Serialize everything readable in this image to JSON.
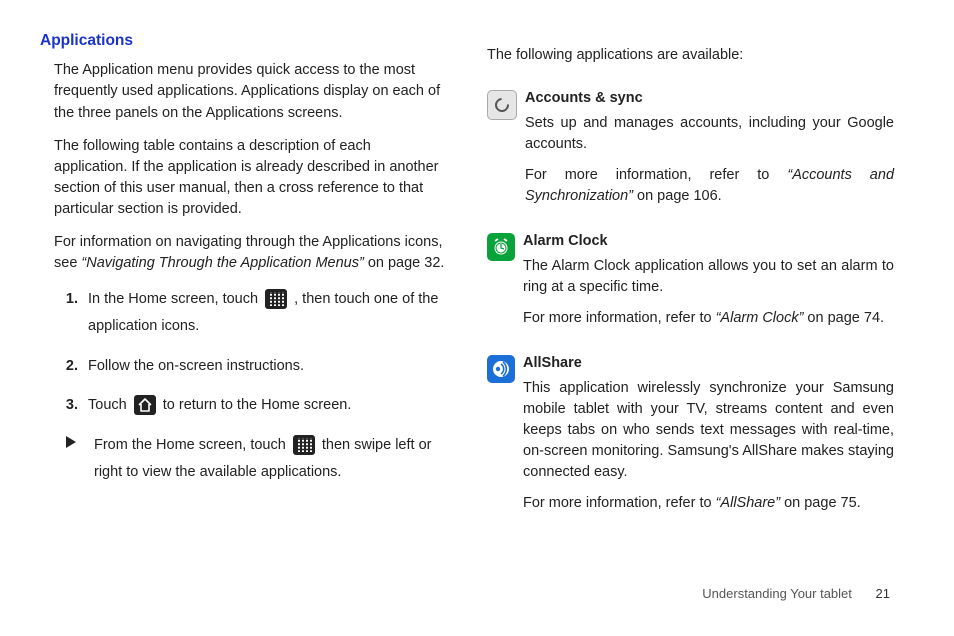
{
  "left": {
    "heading": "Applications",
    "p1": "The Application menu provides quick access to the most frequently used applications. Applications display on each of the three panels on the Applications screens.",
    "p2": "The following table contains a description of each application. If the application is already described in another section of this user manual, then a cross reference to that particular section is provided.",
    "p3a": "For information on navigating through the Applications icons, see ",
    "p3ref": "“Navigating Through the Application Menus”",
    "p3b": " on page 32.",
    "step1a": "In the Home screen, touch ",
    "step1b": " , then touch one of the application icons.",
    "step2": "Follow the on-screen instructions.",
    "step3a": "Touch ",
    "step3b": " to return to the Home screen.",
    "bulleta": "From the Home screen, touch ",
    "bulletb": " then swipe left or right to view the available applications."
  },
  "right": {
    "intro": "The following applications are available:",
    "apps": {
      "sync": {
        "title": "Accounts & sync",
        "desc": "Sets up and manages accounts, including your Google accounts.",
        "morea": "For more information, refer to ",
        "moreref": "“Accounts and Synchronization”",
        "moreb": "  on page 106."
      },
      "alarm": {
        "title": "Alarm Clock",
        "desc": "The Alarm Clock application allows you to set an alarm to ring at a specific time.",
        "morea": "For more information, refer to ",
        "moreref": "“Alarm Clock”",
        "moreb": "  on page 74."
      },
      "allshare": {
        "title": "AllShare",
        "desc": "This application wirelessly synchronize your Samsung mobile tablet with your TV, streams content and even keeps tabs on who sends text messages with real-time, on-screen monitoring. Samsung's AllShare makes staying connected easy.",
        "morea": "For more information, refer to ",
        "moreref": "“AllShare”",
        "moreb": "  on page 75."
      }
    }
  },
  "footer": {
    "section": "Understanding Your tablet",
    "page": "21"
  }
}
